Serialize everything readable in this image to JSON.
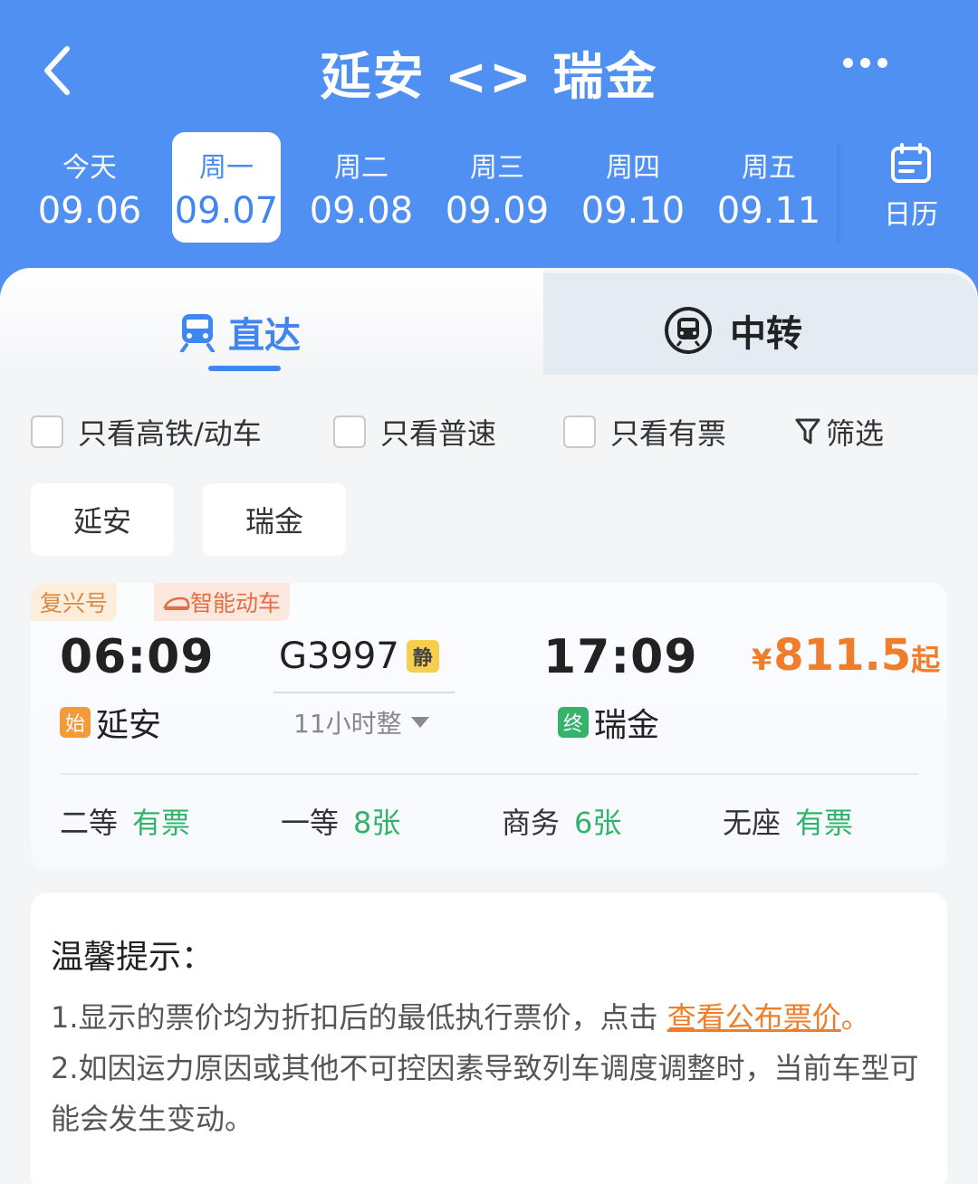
{
  "header": {
    "title": "延安 <> 瑞金",
    "dates": [
      {
        "weekday": "今天",
        "date": "09.06"
      },
      {
        "weekday": "周一",
        "date": "09.07"
      },
      {
        "weekday": "周二",
        "date": "09.08"
      },
      {
        "weekday": "周三",
        "date": "09.09"
      },
      {
        "weekday": "周四",
        "date": "09.10"
      },
      {
        "weekday": "周五",
        "date": "09.11"
      }
    ],
    "selected_date_index": 1,
    "calendar_label": "日历"
  },
  "tabs": {
    "direct": "直达",
    "transfer": "中转",
    "active": "direct"
  },
  "filters": {
    "high_speed": "只看高铁/动车",
    "normal_speed": "只看普速",
    "available": "只看有票",
    "filter_btn": "筛选"
  },
  "stations": {
    "from": "延安",
    "to": "瑞金"
  },
  "train": {
    "tag1": "复兴号",
    "tag2": "智能动车",
    "depart_time": "06:09",
    "arrive_time": "17:09",
    "depart_badge": "始",
    "arrive_badge": "终",
    "depart_station": "延安",
    "arrive_station": "瑞金",
    "number": "G3997",
    "quiet_badge": "静",
    "duration": "11小时整",
    "price_currency": "¥",
    "price_amount": "811.5",
    "price_suffix": "起",
    "seats": [
      {
        "class": "二等",
        "status": "有票"
      },
      {
        "class": "一等",
        "status": "8张"
      },
      {
        "class": "商务",
        "status": "6张"
      },
      {
        "class": "无座",
        "status": "有票"
      }
    ]
  },
  "notice": {
    "title": "温馨提示：",
    "line1_prefix": "1.显示的票价均为折扣后的最低执行票价，点击 ",
    "line1_link": "查看公布票价",
    "line1_suffix": "。",
    "line2": "2.如因运力原因或其他不可控因素导致列车调度调整时，当前车型可能会发生变动。"
  },
  "colors": {
    "header_bg": "#4f90f2",
    "accent_blue": "#3f86f2",
    "price_orange": "#ef7d2a",
    "available_green": "#31b36b"
  }
}
